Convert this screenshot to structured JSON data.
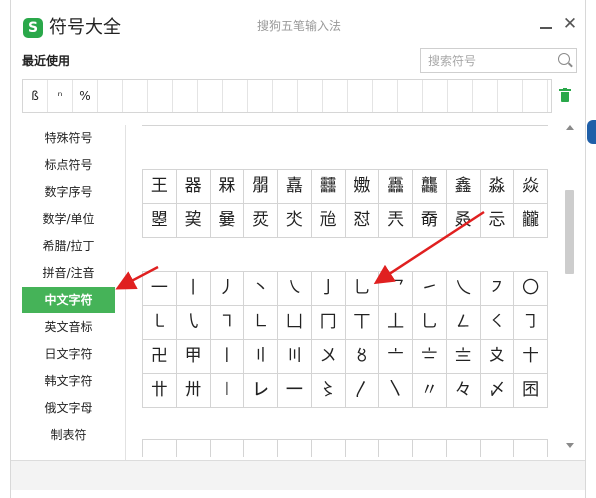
{
  "window": {
    "app_title": "符号大全",
    "ime_name": "搜狗五笔输入法",
    "logo_letter": "S"
  },
  "recent": {
    "label": "最近使用",
    "symbols": [
      "ß",
      "ⁿ",
      "%"
    ],
    "empty_cells": 18
  },
  "search": {
    "placeholder": "搜索符号",
    "value": ""
  },
  "sidebar": {
    "items": [
      {
        "label": "特殊符号",
        "active": false
      },
      {
        "label": "标点符号",
        "active": false
      },
      {
        "label": "数字序号",
        "active": false
      },
      {
        "label": "数学/单位",
        "active": false
      },
      {
        "label": "希腊/拉丁",
        "active": false
      },
      {
        "label": "拼音/注音",
        "active": false
      },
      {
        "label": "中文字符",
        "active": true
      },
      {
        "label": "英文音标",
        "active": false
      },
      {
        "label": "日文字符",
        "active": false
      },
      {
        "label": "韩文字符",
        "active": false
      },
      {
        "label": "俄文字母",
        "active": false
      },
      {
        "label": "制表符",
        "active": false
      }
    ]
  },
  "symbol_groups": [
    {
      "rows": [
        [
          "",
          "",
          "",
          "",
          "",
          "",
          "",
          "",
          "",
          "",
          "",
          ""
        ]
      ]
    },
    {
      "rows": [
        [
          "王",
          "器",
          "槑",
          "朤",
          "嚞",
          "䨻",
          "嫐",
          "靐",
          "龘",
          "鑫",
          "淼",
          "焱"
        ],
        [
          "曌",
          "巭",
          "嘦",
          "烎",
          "氼",
          "兘",
          "怼",
          "兲",
          "奣",
          "叒",
          "忈",
          "龖"
        ]
      ]
    },
    {
      "rows": [
        [
          "一",
          "丨",
          "丿",
          "丶",
          "㇏",
          "亅",
          "乚",
          "乛",
          "㇀",
          "乀",
          "㇇",
          "〇"
        ],
        [
          "㇄",
          "㇂",
          "㇕",
          "㇗",
          "凵",
          "冂",
          "丅",
          "丄",
          "乚",
          "㇜",
          "㇛",
          "㇆"
        ],
        [
          "卍",
          "甲",
          "〡",
          "〢",
          "〣",
          "〤",
          "〥",
          "〦",
          "〧",
          "〨",
          "〩",
          "〸"
        ],
        [
          "〹",
          "〺",
          "㆐",
          "㆑",
          "㆒",
          "〻",
          "〳",
          "〵",
          "〃",
          "々",
          "〆",
          "囨"
        ]
      ]
    },
    {
      "rows": [
        [
          "",
          "",
          "",
          "",
          "",
          "",
          "",
          "",
          "",
          "",
          "",
          ""
        ]
      ]
    }
  ],
  "annotations": {
    "arrow_color": "#e02020"
  },
  "colors": {
    "accent": "#45b358",
    "logo": "#2aa84a",
    "trash": "#2aa84a"
  }
}
